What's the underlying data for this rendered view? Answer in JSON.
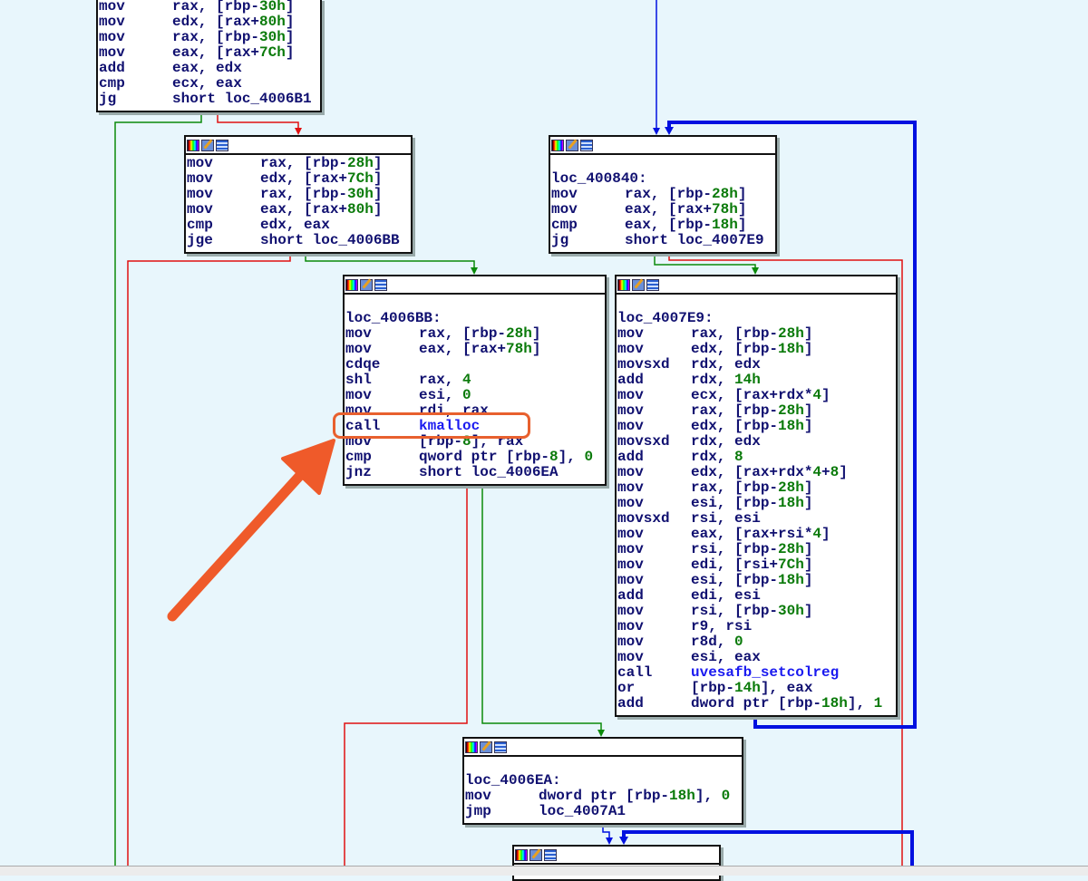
{
  "colors": {
    "background": "#e8f6fc",
    "true_edge": "#0a8a0a",
    "false_edge": "#e01010",
    "jump_edge": "#0010e0",
    "annotation": "#ef5a2a"
  },
  "block_icons": [
    "color-palette-icon",
    "edit-icon",
    "graph-overview-icon"
  ],
  "blocks": [
    {
      "id": "b1",
      "label": null,
      "lines": [
        {
          "op": "mov",
          "args": "rax, [rbp-30h]"
        },
        {
          "op": "mov",
          "args": "edx, [rax+80h]"
        },
        {
          "op": "mov",
          "args": "rax, [rbp-30h]"
        },
        {
          "op": "mov",
          "args": "eax, [rax+7Ch]"
        },
        {
          "op": "add",
          "args": "eax, edx"
        },
        {
          "op": "cmp",
          "args": "ecx, eax"
        },
        {
          "op": "jg",
          "args": "short loc_4006B1"
        }
      ]
    },
    {
      "id": "b2",
      "label": null,
      "lines": [
        {
          "op": "mov",
          "args": "rax, [rbp-28h]"
        },
        {
          "op": "mov",
          "args": "edx, [rax+7Ch]"
        },
        {
          "op": "mov",
          "args": "rax, [rbp-30h]"
        },
        {
          "op": "mov",
          "args": "eax, [rax+80h]"
        },
        {
          "op": "cmp",
          "args": "edx, eax"
        },
        {
          "op": "jge",
          "args": "short loc_4006BB"
        }
      ]
    },
    {
      "id": "b3",
      "label": "loc_400840:",
      "lines": [
        {
          "op": "mov",
          "args": "rax, [rbp-28h]"
        },
        {
          "op": "mov",
          "args": "eax, [rax+78h]"
        },
        {
          "op": "cmp",
          "args": "eax, [rbp-18h]"
        },
        {
          "op": "jg",
          "args": "short loc_4007E9"
        }
      ]
    },
    {
      "id": "b4",
      "label": "loc_4006BB:",
      "lines": [
        {
          "op": "mov",
          "args": "rax, [rbp-28h]"
        },
        {
          "op": "mov",
          "args": "eax, [rax+78h]"
        },
        {
          "op": "cdqe",
          "args": ""
        },
        {
          "op": "shl",
          "args": "rax, 4"
        },
        {
          "op": "mov",
          "args": "esi, 0"
        },
        {
          "op": "mov",
          "args": "rdi, rax"
        },
        {
          "op": "call",
          "args": "kmalloc",
          "call": true
        },
        {
          "op": "mov",
          "args": "[rbp-8], rax"
        },
        {
          "op": "cmp",
          "args": "qword ptr [rbp-8], 0"
        },
        {
          "op": "jnz",
          "args": "short loc_4006EA"
        }
      ]
    },
    {
      "id": "b5",
      "label": "loc_4007E9:",
      "lines": [
        {
          "op": "mov",
          "args": "rax, [rbp-28h]"
        },
        {
          "op": "mov",
          "args": "edx, [rbp-18h]"
        },
        {
          "op": "movsxd",
          "args": "rdx, edx"
        },
        {
          "op": "add",
          "args": "rdx, 14h"
        },
        {
          "op": "mov",
          "args": "ecx, [rax+rdx*4]"
        },
        {
          "op": "mov",
          "args": "rax, [rbp-28h]"
        },
        {
          "op": "mov",
          "args": "edx, [rbp-18h]"
        },
        {
          "op": "movsxd",
          "args": "rdx, edx"
        },
        {
          "op": "add",
          "args": "rdx, 8"
        },
        {
          "op": "mov",
          "args": "edx, [rax+rdx*4+8]"
        },
        {
          "op": "mov",
          "args": "rax, [rbp-28h]"
        },
        {
          "op": "mov",
          "args": "esi, [rbp-18h]"
        },
        {
          "op": "movsxd",
          "args": "rsi, esi"
        },
        {
          "op": "mov",
          "args": "eax, [rax+rsi*4]"
        },
        {
          "op": "mov",
          "args": "rsi, [rbp-28h]"
        },
        {
          "op": "mov",
          "args": "edi, [rsi+7Ch]"
        },
        {
          "op": "mov",
          "args": "esi, [rbp-18h]"
        },
        {
          "op": "add",
          "args": "edi, esi"
        },
        {
          "op": "mov",
          "args": "rsi, [rbp-30h]"
        },
        {
          "op": "mov",
          "args": "r9, rsi"
        },
        {
          "op": "mov",
          "args": "r8d, 0"
        },
        {
          "op": "mov",
          "args": "esi, eax"
        },
        {
          "op": "call",
          "args": "uvesafb_setcolreg",
          "call": true
        },
        {
          "op": "or",
          "args": "[rbp-14h], eax"
        },
        {
          "op": "add",
          "args": "dword ptr [rbp-18h], 1"
        }
      ]
    },
    {
      "id": "b6",
      "label": "loc_4006EA:",
      "lines": [
        {
          "op": "mov",
          "args": "dword ptr [rbp-18h], 0"
        },
        {
          "op": "jmp",
          "args": "loc_4007A1"
        }
      ]
    },
    {
      "id": "b7",
      "label": null,
      "lines": []
    }
  ]
}
